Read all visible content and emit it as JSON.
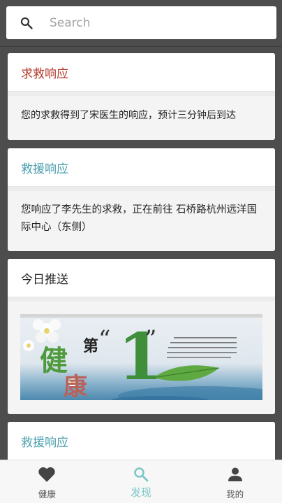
{
  "search": {
    "placeholder": "Search",
    "value": ""
  },
  "cards": [
    {
      "title": "求救响应",
      "title_color": "#b53b2c",
      "body": "您的求救得到了宋医生的响应，预计三分钟后到达"
    },
    {
      "title": "救援响应",
      "title_color": "#4a9eae",
      "body": "您响应了李先生的求救，正在前往 石桥路杭州远洋国际中心（东侧）"
    },
    {
      "title": "今日推送",
      "title_color": "#222222",
      "banner": {
        "big_text_1": "健",
        "big_text_2": "康",
        "small_text": "第",
        "numeral": "1"
      }
    },
    {
      "title": "救援响应",
      "title_color": "#4a9eae"
    }
  ],
  "tabs": [
    {
      "label": "健康",
      "icon": "heart-icon",
      "active": false
    },
    {
      "label": "发现",
      "icon": "search-icon",
      "active": true
    },
    {
      "label": "我的",
      "icon": "person-icon",
      "active": false
    }
  ],
  "colors": {
    "active_tab": "#7cc7c7",
    "background": "#4d4d4d"
  }
}
